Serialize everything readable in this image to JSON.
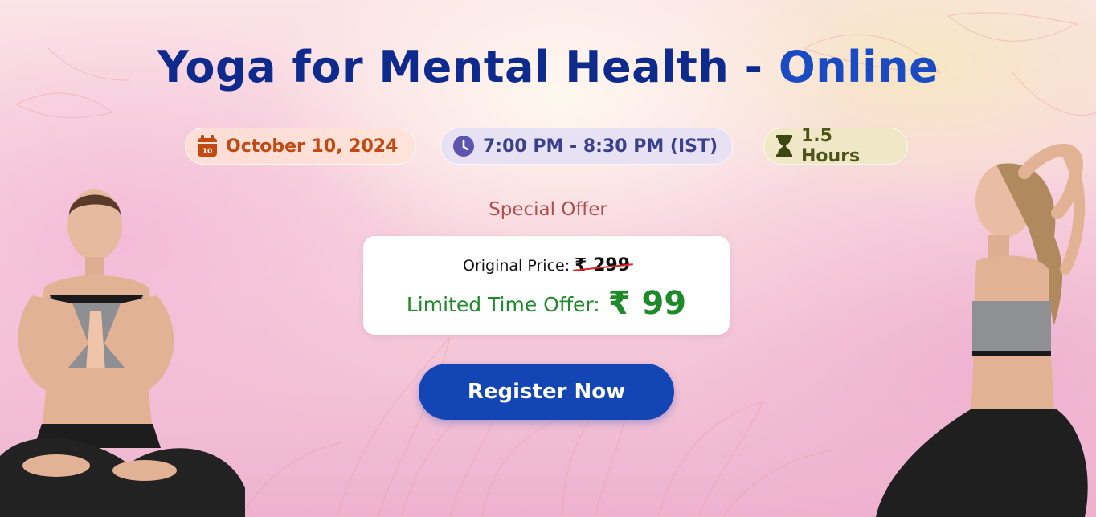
{
  "header": {
    "title_main": "Yoga for Mental Health - ",
    "title_accent": "Online"
  },
  "details": {
    "date": "October 10, 2024",
    "date_icon_number": "10",
    "time": "7:00 PM - 8:30 PM (IST)",
    "duration": "1.5 Hours"
  },
  "offer": {
    "heading": "Special Offer",
    "original_label": "Original Price:",
    "original_price": "₹ 299",
    "limited_label": "Limited Time Offer:",
    "limited_price": "₹ 99"
  },
  "cta": {
    "register_label": "Register Now"
  },
  "icons": {
    "date": "calendar-icon",
    "time": "clock-icon",
    "duration": "hourglass-icon"
  },
  "colors": {
    "title": "#0e2a8c",
    "title_accent": "#1b4bc2",
    "date_text": "#c14a12",
    "time_text": "#3a3f8e",
    "duration_text": "#4c5418",
    "offer_heading": "#b14d4a",
    "limited_price": "#1f8a2a",
    "button": "#1346b4"
  }
}
